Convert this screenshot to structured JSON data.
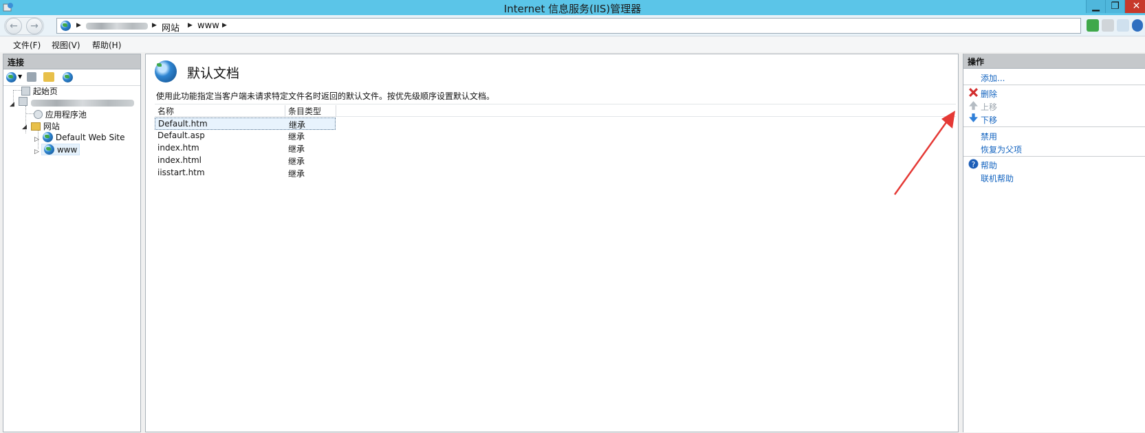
{
  "window": {
    "title": "Internet 信息服务(IIS)管理器"
  },
  "address": {
    "crumbs": [
      "网站",
      "www"
    ]
  },
  "menu": [
    "文件(F)",
    "视图(V)",
    "帮助(H)"
  ],
  "connections": {
    "header": "连接",
    "tree": {
      "start_page": "起始页",
      "app_pools": "应用程序池",
      "sites": "网站",
      "default_site": "Default Web Site",
      "www": "www"
    }
  },
  "main": {
    "title": "默认文档",
    "description": "使用此功能指定当客户端未请求特定文件名时返回的默认文件。按优先级顺序设置默认文档。",
    "columns": [
      "名称",
      "条目类型"
    ],
    "rows": [
      {
        "name": "Default.htm",
        "type": "继承"
      },
      {
        "name": "Default.asp",
        "type": "继承"
      },
      {
        "name": "index.htm",
        "type": "继承"
      },
      {
        "name": "index.html",
        "type": "继承"
      },
      {
        "name": "iisstart.htm",
        "type": "继承"
      }
    ],
    "selected_row": 0
  },
  "actions": {
    "header": "操作",
    "add": "添加...",
    "remove": "删除",
    "move_up": "上移",
    "move_down": "下移",
    "disable": "禁用",
    "revert": "恢复为父项",
    "help": "帮助",
    "online_help": "联机帮助"
  },
  "colors": {
    "titlebar": "#5bc5e8",
    "link": "#1565c0",
    "annotation_arrow": "#e53935"
  }
}
